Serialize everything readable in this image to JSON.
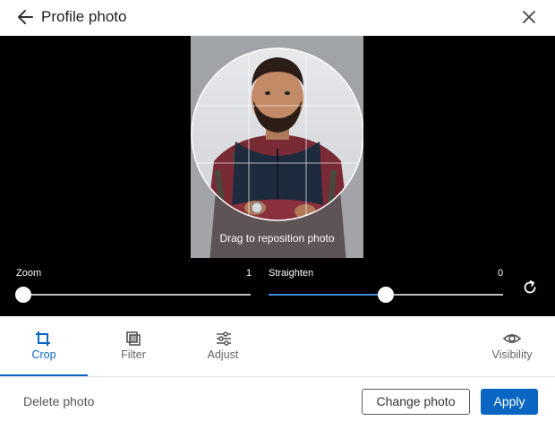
{
  "header": {
    "title": "Profile photo",
    "back_icon": "arrow-left-icon",
    "close_icon": "close-icon"
  },
  "editor": {
    "drag_hint": "Drag to reposition photo",
    "zoom": {
      "label": "Zoom",
      "value": "1",
      "level": 0.0
    },
    "straighten": {
      "label": "Straighten",
      "value": "0",
      "level": 0.5
    },
    "reset_icon": "rotate-reset-icon"
  },
  "toolbar": {
    "items": [
      {
        "label": "Crop",
        "icon": "crop-icon",
        "active": true
      },
      {
        "label": "Filter",
        "icon": "filter-icon",
        "active": false
      },
      {
        "label": "Adjust",
        "icon": "adjust-sliders-icon",
        "active": false
      },
      {
        "label": "Visibility",
        "icon": "eye-icon",
        "active": false
      }
    ]
  },
  "footer": {
    "delete_label": "Delete photo",
    "change_label": "Change photo",
    "apply_label": "Apply"
  },
  "colors": {
    "accent": "#0a66c2",
    "editor_bg": "#000000",
    "slider_fill": "#3d8bd9"
  }
}
